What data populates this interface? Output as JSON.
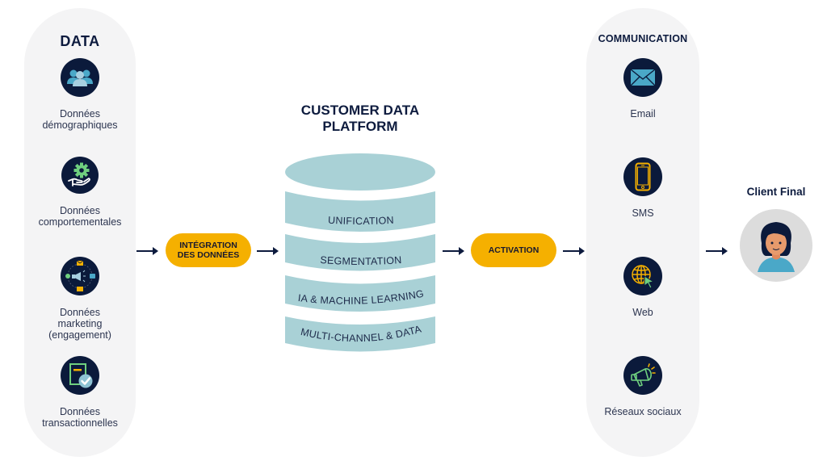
{
  "data_panel": {
    "title": "DATA",
    "items": [
      {
        "icon": "people-group-icon",
        "label": "Données\ndémographiques"
      },
      {
        "icon": "gear-hand-icon",
        "label": "Données\ncomportementales"
      },
      {
        "icon": "megaphone-channels-icon",
        "label": "Données\nmarketing\n(engagement)"
      },
      {
        "icon": "document-check-icon",
        "label": "Données\ntransactionnelles"
      }
    ]
  },
  "integration": {
    "label": "INTÉGRATION\nDES DONNÉES"
  },
  "cdp": {
    "title": "CUSTOMER DATA\nPLATFORM",
    "layers": [
      "UNIFICATION",
      "SEGMENTATION",
      "IA & MACHINE LEARNING",
      "MULTI-CHANNEL & DATA"
    ]
  },
  "activation": {
    "label": "ACTIVATION"
  },
  "communication_panel": {
    "title": "COMMUNICATION",
    "items": [
      {
        "icon": "envelope-icon",
        "label": "Email"
      },
      {
        "icon": "smartphone-icon",
        "label": "SMS"
      },
      {
        "icon": "globe-cursor-icon",
        "label": "Web"
      },
      {
        "icon": "megaphone-icon",
        "label": "Réseaux sociaux"
      }
    ]
  },
  "client": {
    "title": "Client Final",
    "icon": "woman-avatar-icon"
  },
  "colors": {
    "panel_bg": "#f4f4f5",
    "navy": "#0b1a3b",
    "accent_yellow": "#f5b000",
    "cylinder": "#a9d1d6",
    "green": "#6fcf7f",
    "light_blue": "#4aa8c8"
  }
}
